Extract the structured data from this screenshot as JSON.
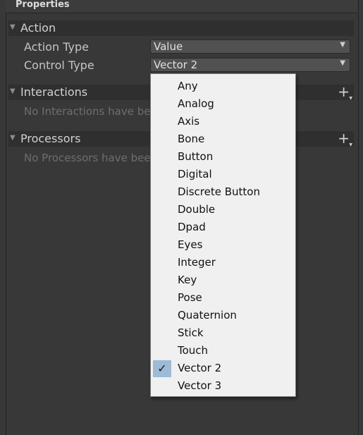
{
  "panel": {
    "title": "Properties"
  },
  "action_section": {
    "title": "Action",
    "action_type": {
      "label": "Action Type",
      "value": "Value"
    },
    "control_type": {
      "label": "Control Type",
      "value": "Vector 2"
    }
  },
  "interactions_section": {
    "title": "Interactions",
    "empty_text": "No Interactions have be"
  },
  "processors_section": {
    "title": "Processors",
    "empty_text": "No Processors have bee"
  },
  "control_type_menu": {
    "selected": "Vector 2",
    "items": [
      "Any",
      "Analog",
      "Axis",
      "Bone",
      "Button",
      "Digital",
      "Discrete Button",
      "Double",
      "Dpad",
      "Eyes",
      "Integer",
      "Key",
      "Pose",
      "Quaternion",
      "Stick",
      "Touch",
      "Vector 2",
      "Vector 3"
    ]
  },
  "colors": {
    "menu_check_highlight": "#9dbad6",
    "panel_bg": "#383838"
  },
  "icons": {
    "expand": "triangle-down-icon",
    "add": "plus-icon",
    "dropdown": "chevron-down-icon",
    "check": "checkmark-icon"
  }
}
